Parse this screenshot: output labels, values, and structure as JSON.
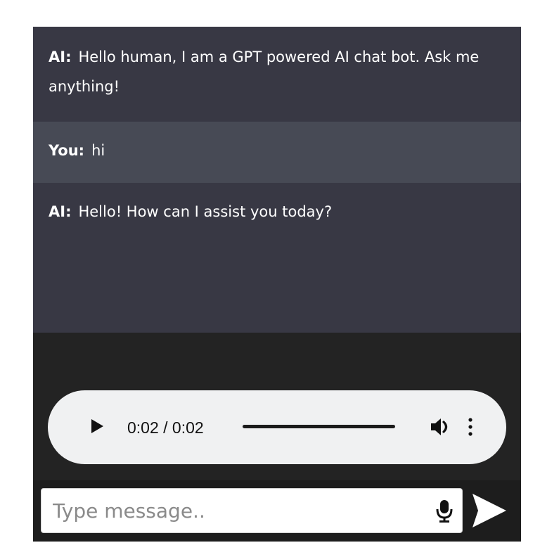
{
  "messages": [
    {
      "sender": "AI:",
      "text": "Hello human, I am a GPT powered AI chat bot. Ask me anything!"
    },
    {
      "sender": "You:",
      "text": "hi"
    },
    {
      "sender": "AI:",
      "text": "Hello! How can I assist you today?"
    }
  ],
  "audio_player": {
    "time": "0:02 / 0:02",
    "progress": 1.0,
    "icons": {
      "play": "play-icon",
      "volume": "volume-icon",
      "menu": "more-vertical-icon"
    }
  },
  "composer": {
    "placeholder": "Type message..",
    "value": "",
    "icons": {
      "mic": "microphone-icon",
      "send": "send-icon"
    }
  },
  "colors": {
    "ai_bg": "#383844",
    "user_bg": "#474a55",
    "window_bg": "#232323",
    "player_bg": "#f0f1f2"
  }
}
